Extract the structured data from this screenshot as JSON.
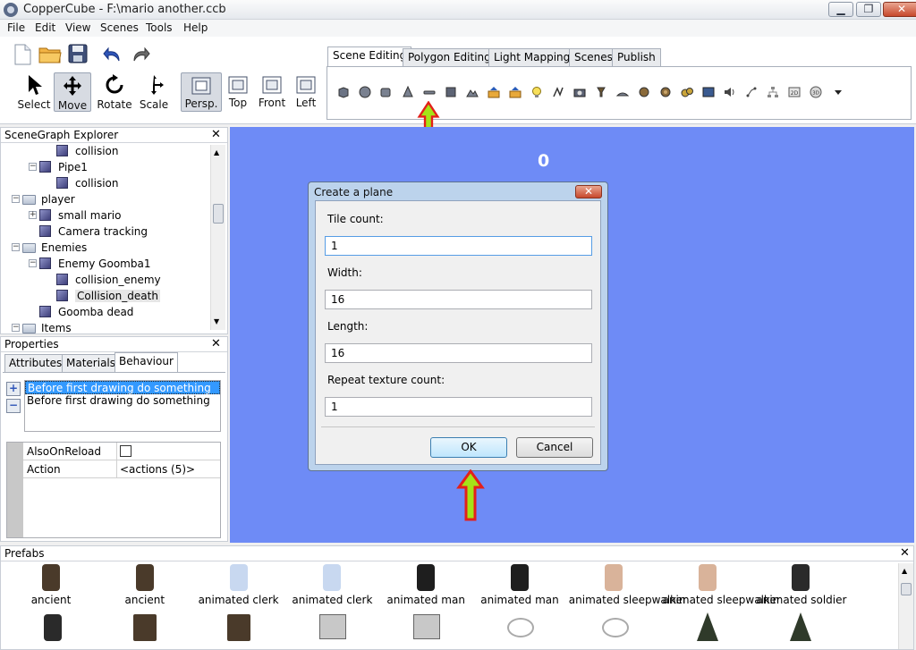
{
  "window": {
    "title": "CopperCube - F:\\mario another.ccb",
    "minimize": "▁",
    "maximize": "❐",
    "close": "✕"
  },
  "menu": [
    "File",
    "Edit",
    "View",
    "Scenes",
    "Tools",
    "Help"
  ],
  "toolbar": {
    "tools": [
      "Select",
      "Move",
      "Rotate",
      "Scale"
    ],
    "views": [
      "Persp.",
      "Top",
      "Front",
      "Left"
    ],
    "active_tool": "Move",
    "active_view": "Persp."
  },
  "tabs": [
    "Scene Editing",
    "Polygon Editing",
    "Light Mapping",
    "Scenes",
    "Publish"
  ],
  "scenegraph": {
    "title": "SceneGraph Explorer",
    "close": "✕",
    "items": [
      {
        "label": "collision",
        "icon": "cube-icon",
        "indent": 3
      },
      {
        "label": "Pipe1",
        "icon": "cube-icon",
        "indent": 2
      },
      {
        "label": "collision",
        "icon": "cube-icon",
        "indent": 3
      },
      {
        "label": "player",
        "icon": "folder-icon",
        "indent": 1
      },
      {
        "label": "small mario",
        "icon": "cube-icon",
        "indent": 2
      },
      {
        "label": "Camera tracking",
        "icon": "cube-icon",
        "indent": 2
      },
      {
        "label": "Enemies",
        "icon": "folder-icon",
        "indent": 1
      },
      {
        "label": "Enemy Goomba1",
        "icon": "cube-icon",
        "indent": 2
      },
      {
        "label": "collision_enemy",
        "icon": "cube-icon",
        "indent": 3
      },
      {
        "label": "Collision_death",
        "icon": "cube-icon",
        "indent": 3
      },
      {
        "label": "Goomba dead",
        "icon": "cube-icon",
        "indent": 2
      },
      {
        "label": "Items",
        "icon": "folder-icon",
        "indent": 1
      }
    ]
  },
  "properties": {
    "title": "Properties",
    "close": "✕",
    "tabs": [
      "Attributes",
      "Materials",
      "Behaviour"
    ],
    "active_tab": "Behaviour",
    "behaviours": [
      "Before first drawing do something",
      "Before first drawing do something"
    ],
    "add": "+",
    "remove": "−",
    "grid": [
      {
        "name": "AlsoOnReload",
        "value": ""
      },
      {
        "name": "Action",
        "value": "<actions (5)>"
      }
    ]
  },
  "viewport": {
    "score": "0"
  },
  "dialog": {
    "title": "Create a plane",
    "close": "✕",
    "fields": [
      {
        "label": "Tile count:",
        "value": "1"
      },
      {
        "label": "Width:",
        "value": "16"
      },
      {
        "label": "Length:",
        "value": "16"
      },
      {
        "label": "Repeat texture count:",
        "value": "1"
      }
    ],
    "ok": "OK",
    "cancel": "Cancel"
  },
  "prefabs": {
    "title": "Prefabs",
    "close": "✕",
    "items": [
      {
        "label": "ancient",
        "color": "#4a3a2a"
      },
      {
        "label": "ancient",
        "color": "#4a3a2a"
      },
      {
        "label": "animated clerk",
        "color": "#c8d8f0"
      },
      {
        "label": "animated clerk",
        "color": "#c8d8f0"
      },
      {
        "label": "animated man",
        "color": "#1e1e1e"
      },
      {
        "label": "animated man",
        "color": "#1e1e1e"
      },
      {
        "label": "animated sleepwalker",
        "color": "#d9b39a"
      },
      {
        "label": "animated sleepwalker",
        "color": "#d9b39a"
      },
      {
        "label": "animated soldier",
        "color": "#2a2a2a"
      }
    ]
  },
  "colors": {
    "viewport_bg": "#6e8bf6",
    "arrow_fill": "#a5e317",
    "arrow_stroke": "#e3201a",
    "selection": "#3399ff"
  }
}
